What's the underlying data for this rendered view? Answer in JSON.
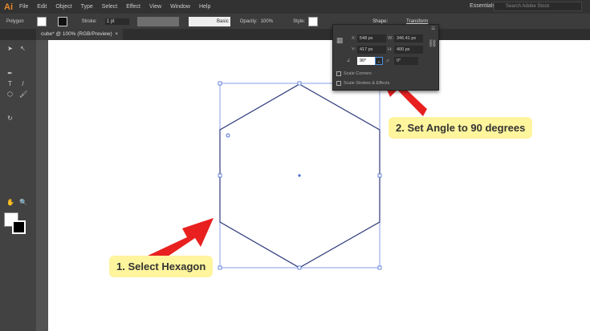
{
  "menubar": {
    "logo": "Ai",
    "items": [
      "File",
      "Edit",
      "Object",
      "Type",
      "Select",
      "Effect",
      "View",
      "Window",
      "Help"
    ],
    "workspace": "Essentials",
    "search_placeholder": "Search Adobe Stock"
  },
  "control": {
    "object_type": "Polygon",
    "stroke_label": "Stroke:",
    "stroke_value": "1 pt",
    "brush": "Basic",
    "opacity_label": "Opacity:",
    "opacity_value": "100%",
    "style_label": "Style:",
    "shape_label": "Shape:",
    "transform_label": "Transform"
  },
  "document": {
    "tab": "cube* @ 100% (RGB/Preview)",
    "close": "×"
  },
  "transform_panel": {
    "x_label": "X:",
    "x": "548 px",
    "y_label": "Y:",
    "y": "417 px",
    "w_label": "W:",
    "w": "346.41 px",
    "h_label": "H:",
    "h": "400 px",
    "angle": "90°",
    "shear": "0°",
    "scale_corners": "Scale Corners",
    "scale_strokes": "Scale Strokes & Effects"
  },
  "callouts": {
    "step1": "1. Select Hexagon",
    "step2": "2. Set Angle to 90 degrees"
  },
  "colors": {
    "arrow": "#e82020",
    "callout": "#fff59d",
    "selection": "#4a6cd4"
  }
}
